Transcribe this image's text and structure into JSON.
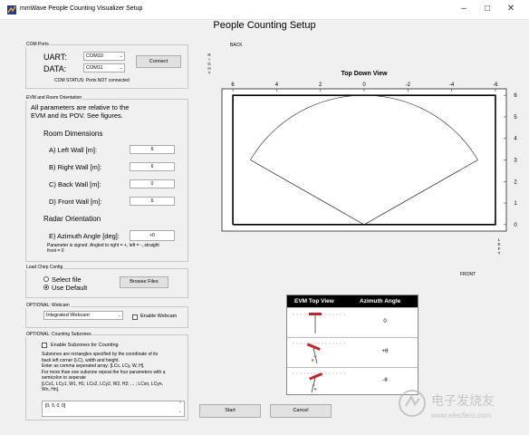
{
  "window": {
    "title": "mmWave People Counting Visualizer Setup",
    "minimize": "–",
    "maximize": "□",
    "close": "✕"
  },
  "page_title": "People Counting Setup",
  "com_ports": {
    "title": "COM Ports",
    "uart_label": "UART:",
    "uart_value": "COM10",
    "data_label": "DATA:",
    "data_value": "COM11",
    "connect_label": "Connect",
    "status": "COM STATUS: Ports NOT connected"
  },
  "evm": {
    "title": "EVM and Room Orientation",
    "intro": "All parameters are relative to the EVM and its POV.  See figures.",
    "room_heading": "Room Dimensions",
    "left_wall_label": "A) Left Wall [m]:",
    "left_wall_value": "6",
    "right_wall_label": "B) Right Wall [m]:",
    "right_wall_value": "6",
    "back_wall_label": "C) Back Wall [m]:",
    "back_wall_value": "0",
    "front_wall_label": "D) Front Wall [m]:",
    "front_wall_value": "6",
    "radar_heading": "Radar Orientation",
    "azimuth_label": "E) Azimuth Angle [deg]:",
    "azimuth_value": "+0",
    "azimuth_note": "Parameter is signed. Angled to right = +, left = -, straight front = 0"
  },
  "chirp": {
    "title": "Load Chirp Config",
    "select_file": "Select file",
    "use_default": "Use Default",
    "browse_label": "Browse Files"
  },
  "webcam": {
    "title": "OPTIONAL: Webcam",
    "device": "Integrated Webcam",
    "enable_label": "Enable Webcam"
  },
  "subzones": {
    "title": "OPTIONAL: Counting Subzones",
    "enable_label": "Enable Subzones for Counting",
    "desc1": "Subzones are rectangles specified by the coordinate of its",
    "desc2": "back left corner (LC), width and height.",
    "desc3": "Enter as comma seperated array: [LCx, LCy, W, H].",
    "desc4": "For more than one subzone repeat the four parameters with a",
    "desc5": "semicolon to seperate",
    "desc6": "[LCx1, LCy1, W1, H1; LCx2, LCy2, W2, H2; ... ; LCxn, LCyn,",
    "desc7": "Wn, Hn].",
    "value": "[0, 0, 0, 0]"
  },
  "actions": {
    "start": "Start",
    "cancel": "Cancel"
  },
  "plot": {
    "back_label": "BACK",
    "front_label": "FRONT",
    "right_letters": [
      "R",
      "I",
      "G",
      "H",
      "T"
    ],
    "left_letters": [
      "L",
      "E",
      "F",
      "T"
    ],
    "title": "Top Down View"
  },
  "chart_data": {
    "type": "line",
    "title": "Top Down View",
    "xlabel": "",
    "ylabel": "",
    "xlim": [
      6.5,
      -6.5
    ],
    "ylim": [
      6.3,
      -0.3
    ],
    "x_ticks": [
      "6",
      "4",
      "2",
      "0",
      "-2",
      "-4",
      "-6"
    ],
    "y_ticks": [
      "0",
      "1",
      "2",
      "3",
      "4",
      "5",
      "6"
    ],
    "grid": false,
    "series": [
      {
        "shape": "room",
        "x": [
          6,
          -6,
          -6,
          6,
          6
        ],
        "y": [
          0,
          0,
          6,
          6,
          0
        ]
      },
      {
        "shape": "fov-edges",
        "x": [
          5.196,
          0,
          -5.196
        ],
        "y": [
          3,
          0,
          3
        ]
      },
      {
        "shape": "fov-arc",
        "center": [
          0,
          0
        ],
        "radius": 6,
        "angle_range_deg": [
          -60,
          60
        ]
      }
    ]
  },
  "evm_table": {
    "col1": "EVM Top View",
    "col2": "Azimuth Angle",
    "rows": [
      {
        "value": "0",
        "theta": ""
      },
      {
        "value": "+θ",
        "theta": "θ"
      },
      {
        "value": "-θ",
        "theta": "θ"
      }
    ]
  },
  "watermark": {
    "brand": "电子发烧友",
    "url": "www.elecfans.com"
  }
}
